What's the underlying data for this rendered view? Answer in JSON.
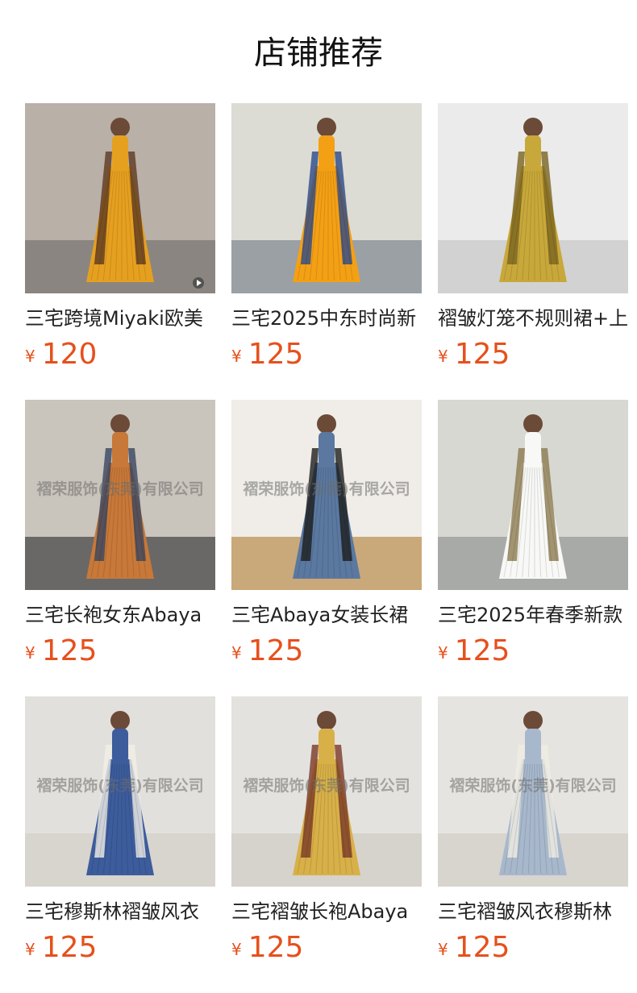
{
  "section": {
    "title": "店铺推荐"
  },
  "products": [
    {
      "name": "三宅跨境Miyaki欧美",
      "currency": "¥",
      "price": "120",
      "watermark": "",
      "has_video": true,
      "palette": {
        "bg": "#b9b0a7",
        "floor": "#8a8580",
        "dress": "#e6a020",
        "accent": "#5c3a22"
      }
    },
    {
      "name": "三宅2025中东时尚新",
      "currency": "¥",
      "price": "125",
      "watermark": "",
      "has_video": false,
      "palette": {
        "bg": "#dcdcd4",
        "floor": "#9aa0a4",
        "dress": "#f4a015",
        "accent": "#2c4a8a"
      }
    },
    {
      "name": "褶皱灯笼不规则裙+上",
      "currency": "¥",
      "price": "125",
      "watermark": "",
      "has_video": false,
      "palette": {
        "bg": "#ebebeb",
        "floor": "#d2d2d2",
        "dress": "#c8a83a",
        "accent": "#7a6420"
      }
    },
    {
      "name": "三宅长袍女东Abaya",
      "currency": "¥",
      "price": "125",
      "watermark": "褶荣服饰(东莞)有限公司",
      "has_video": false,
      "palette": {
        "bg": "#c9c4bc",
        "floor": "#6a6866",
        "dress": "#c87838",
        "accent": "#3a4660"
      }
    },
    {
      "name": "三宅Abaya女装长裙",
      "currency": "¥",
      "price": "125",
      "watermark": "褶荣服饰(东莞)有限公司",
      "has_video": false,
      "palette": {
        "bg": "#f0ede8",
        "floor": "#c9a87a",
        "dress": "#5a78a0",
        "accent": "#1e1e1e"
      }
    },
    {
      "name": "三宅2025年春季新款",
      "currency": "¥",
      "price": "125",
      "watermark": "",
      "has_video": false,
      "palette": {
        "bg": "#d8d8d2",
        "floor": "#a8aaa8",
        "dress": "#f8f8f6",
        "accent": "#8c7a50"
      }
    },
    {
      "name": "三宅穆斯林褶皱风衣",
      "currency": "¥",
      "price": "125",
      "watermark": "褶荣服饰(东莞)有限公司",
      "has_video": false,
      "palette": {
        "bg": "#e2e0dc",
        "floor": "#d8d4ce",
        "dress": "#3c5c9c",
        "accent": "#f2efe6"
      }
    },
    {
      "name": "三宅褶皱长袍Abaya",
      "currency": "¥",
      "price": "125",
      "watermark": "褶荣服饰(东莞)有限公司",
      "has_video": false,
      "palette": {
        "bg": "#e4e2de",
        "floor": "#d6d2cc",
        "dress": "#d8b048",
        "accent": "#7a3a28"
      }
    },
    {
      "name": "三宅褶皱风衣穆斯林",
      "currency": "¥",
      "price": "125",
      "watermark": "褶荣服饰(东莞)有限公司",
      "has_video": false,
      "palette": {
        "bg": "#e6e4e0",
        "floor": "#d8d4ce",
        "dress": "#a8b8cc",
        "accent": "#f0ece2"
      }
    }
  ]
}
